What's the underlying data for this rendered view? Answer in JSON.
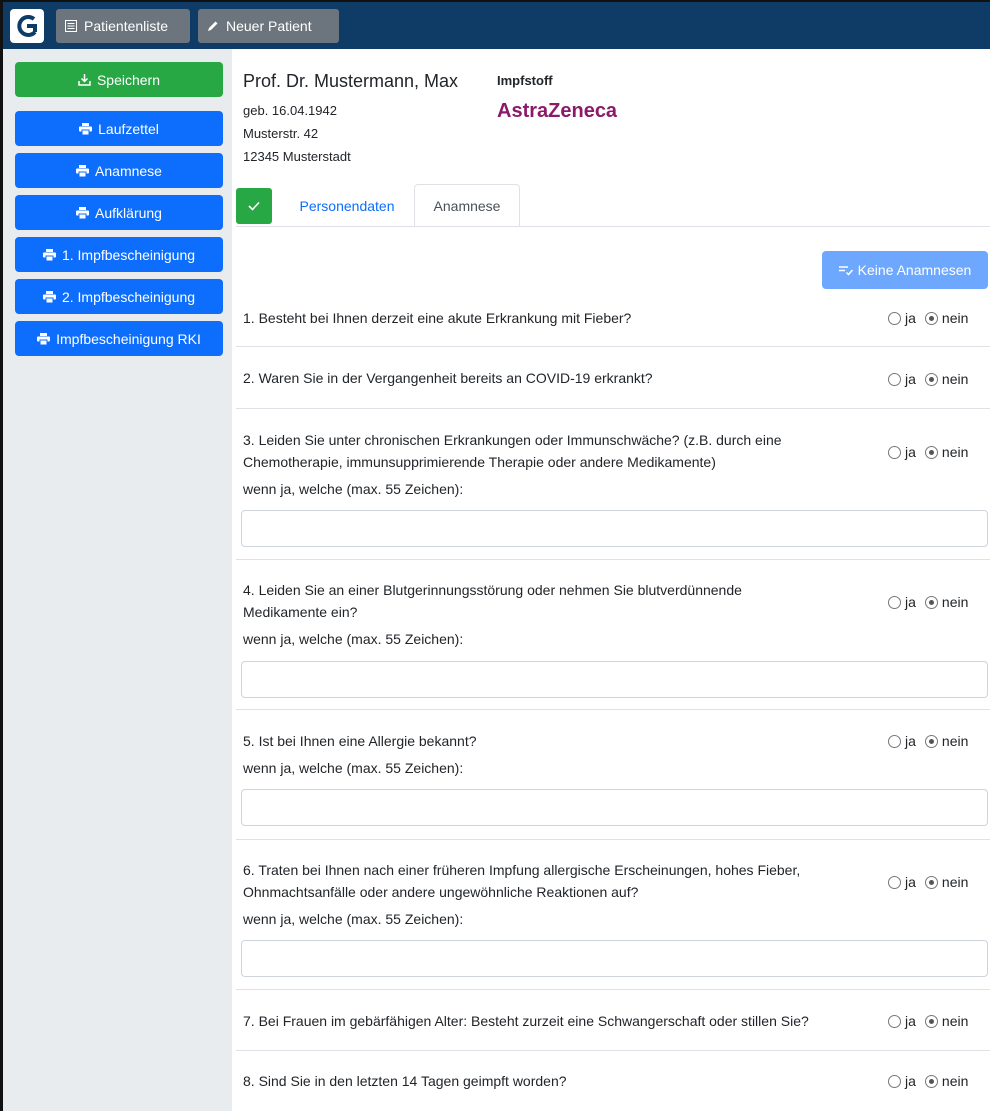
{
  "nav": {
    "patients_label": "Patientenliste",
    "new_patient_label": "Neuer Patient"
  },
  "sidebar": {
    "items": [
      {
        "label": "Speichern",
        "icon": "download-icon"
      },
      {
        "label": "Laufzettel",
        "icon": "printer-icon"
      },
      {
        "label": "Anamnese",
        "icon": "printer-icon"
      },
      {
        "label": "Aufklärung",
        "icon": "printer-icon"
      },
      {
        "label": "1. Impfbescheinigung",
        "icon": "printer-icon"
      },
      {
        "label": "2. Impfbescheinigung",
        "icon": "printer-icon"
      },
      {
        "label": "Impfbescheinigung RKI",
        "icon": "printer-icon"
      }
    ]
  },
  "patient": {
    "name": "Prof. Dr. Mustermann, Max",
    "birth": "geb. 16.04.1942",
    "street": "Musterstr. 42",
    "city": "12345 Musterstadt",
    "vaccine_label": "Impfstoff",
    "vaccine": "AstraZeneca"
  },
  "tabs": [
    {
      "label": "Personendaten",
      "active": false
    },
    {
      "label": "Anamnese",
      "active": true
    }
  ],
  "keine_button": "Keine Anamnesen",
  "radio_labels": {
    "yes": "ja",
    "no": "nein"
  },
  "questions": [
    {
      "lines": [
        "1. Besteht bei Ihnen derzeit eine akute Erkrankung mit Fieber?"
      ],
      "answer": "nein"
    },
    {
      "lines": [
        "2. Waren Sie in der Vergangenheit bereits an COVID-19 erkrankt?"
      ],
      "answer": "nein"
    },
    {
      "lines": [
        "3. Leiden Sie unter chronischen Erkrankungen oder Immunschwäche? (z.B. durch eine",
        "Chemotherapie, immunsupprimierende Therapie oder andere Medikamente)"
      ],
      "answer": "nein",
      "note": "wenn ja, welche (max. 55 Zeichen):",
      "input_value": ""
    },
    {
      "lines": [
        "4. Leiden Sie an einer Blutgerinnungsstörung oder nehmen Sie blutverdünnende",
        "Medikamente ein?"
      ],
      "answer": "nein",
      "note": "wenn ja, welche (max. 55 Zeichen):",
      "input_value": ""
    },
    {
      "lines": [
        "5. Ist bei Ihnen eine Allergie bekannt?"
      ],
      "answer": "nein",
      "note": "wenn ja, welche (max. 55 Zeichen):",
      "input_value": ""
    },
    {
      "lines": [
        "6. Traten bei Ihnen nach einer früheren Impfung allergische Erscheinungen, hohes Fieber,",
        "Ohnmachtsanfälle oder andere ungewöhnliche Reaktionen auf?"
      ],
      "answer": "nein",
      "note": "wenn ja, welche (max. 55 Zeichen):",
      "input_value": ""
    },
    {
      "lines": [
        "7. Bei Frauen im gebärfähigen Alter: Besteht zurzeit eine Schwangerschaft oder stillen Sie?"
      ],
      "answer": "nein"
    },
    {
      "lines": [
        "8. Sind Sie in den letzten 14 Tagen geimpft worden?"
      ],
      "answer": "nein"
    }
  ]
}
